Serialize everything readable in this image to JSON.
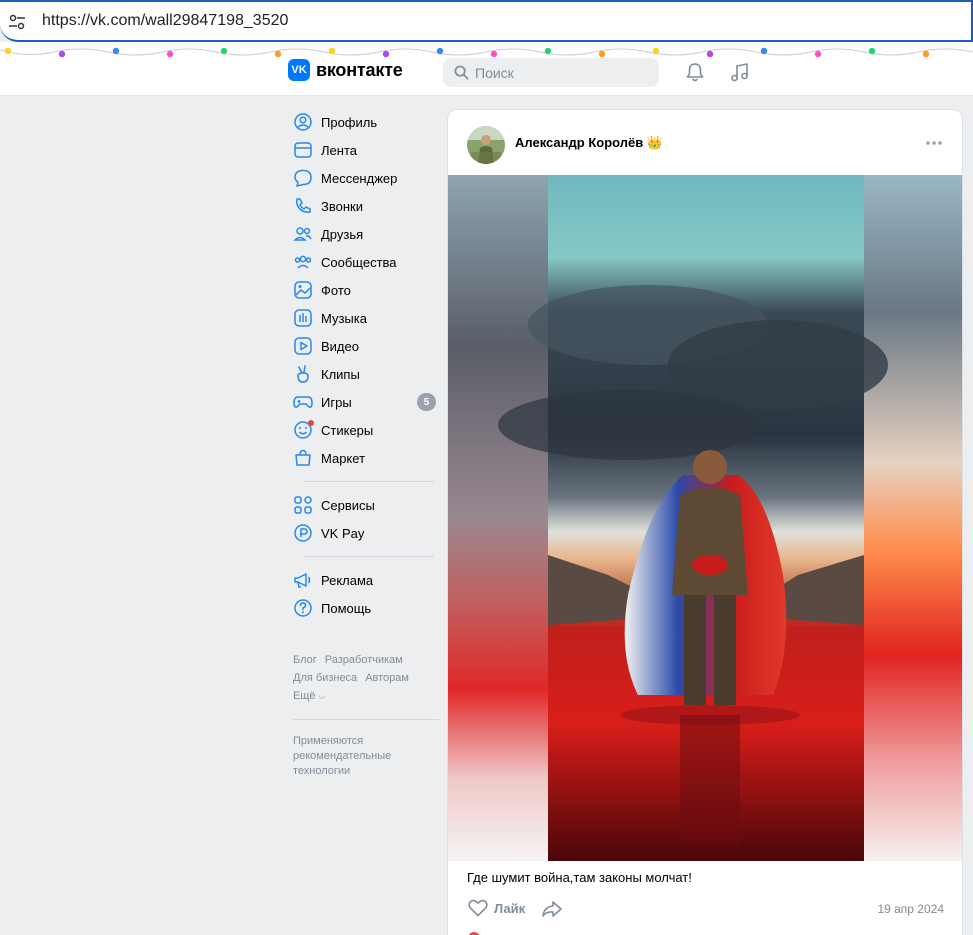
{
  "browser": {
    "url": "https://vk.com/wall29847198_3520"
  },
  "header": {
    "logo_badge": "VK",
    "logo_text": "вконтакте",
    "search_placeholder": "Поиск"
  },
  "nav": {
    "items": [
      {
        "label": "Профиль",
        "icon": "profile-icon"
      },
      {
        "label": "Лента",
        "icon": "feed-icon"
      },
      {
        "label": "Мессенджер",
        "icon": "messenger-icon"
      },
      {
        "label": "Звонки",
        "icon": "phone-icon"
      },
      {
        "label": "Друзья",
        "icon": "friends-icon"
      },
      {
        "label": "Сообщества",
        "icon": "communities-icon"
      },
      {
        "label": "Фото",
        "icon": "photo-icon"
      },
      {
        "label": "Музыка",
        "icon": "music-icon"
      },
      {
        "label": "Видео",
        "icon": "video-icon"
      },
      {
        "label": "Клипы",
        "icon": "clips-icon"
      },
      {
        "label": "Игры",
        "icon": "games-icon",
        "badge": "5"
      },
      {
        "label": "Стикеры",
        "icon": "stickers-icon"
      },
      {
        "label": "Маркет",
        "icon": "market-icon"
      }
    ],
    "services": [
      {
        "label": "Сервисы",
        "icon": "services-icon"
      },
      {
        "label": "VK Pay",
        "icon": "vkpay-icon"
      }
    ],
    "extra": [
      {
        "label": "Реклама",
        "icon": "ads-icon"
      },
      {
        "label": "Помощь",
        "icon": "help-icon"
      }
    ]
  },
  "footer": {
    "links": [
      "Блог",
      "Разработчикам",
      "Для бизнеса",
      "Авторам",
      "Ещё"
    ],
    "note": "Применяются рекомендательные технологии"
  },
  "post": {
    "author": "Александр Королёв 👑",
    "text": "Где шумит война,там законы молчат!",
    "like_label": "Лайк",
    "date": "19 апр 2024"
  },
  "colors": {
    "accent": "#0077ff",
    "badge": "#99a2ad",
    "muted": "#818c99",
    "url_border": "#1a5fbf"
  }
}
